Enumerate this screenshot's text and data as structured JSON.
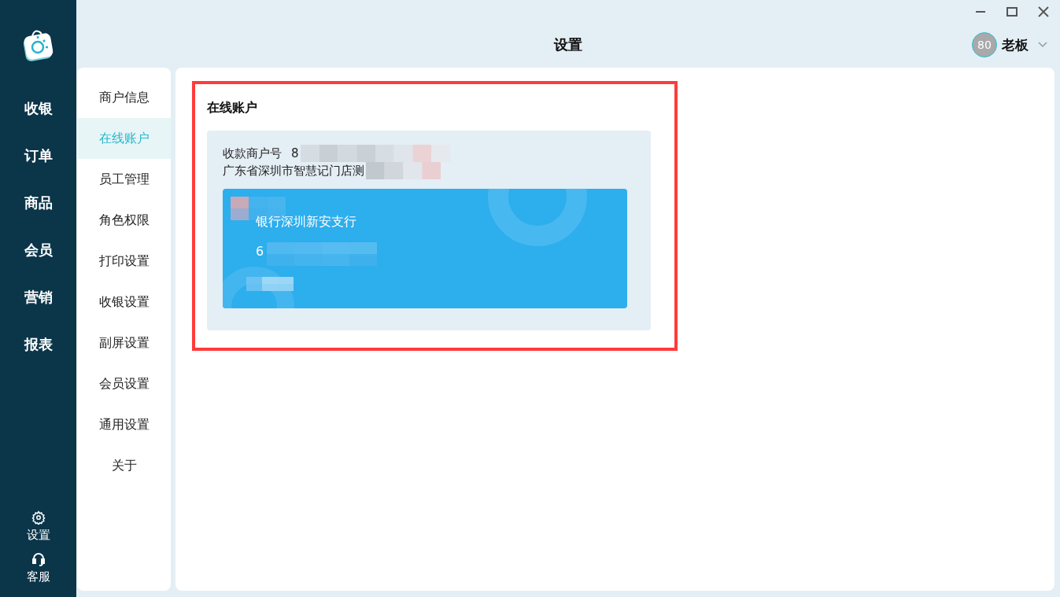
{
  "app_sidebar": {
    "nav_items": [
      {
        "label": "收银"
      },
      {
        "label": "订单"
      },
      {
        "label": "商品"
      },
      {
        "label": "会员"
      },
      {
        "label": "营销"
      },
      {
        "label": "报表"
      }
    ],
    "bottom_items": [
      {
        "kind": "settings",
        "label": "设置"
      },
      {
        "kind": "support",
        "label": "客服"
      }
    ]
  },
  "header": {
    "title": "设置",
    "user": {
      "avatar_text": "80",
      "name": "老板"
    }
  },
  "settings_menu": [
    {
      "label": "商户信息",
      "selected": false
    },
    {
      "label": "在线账户",
      "selected": true
    },
    {
      "label": "员工管理",
      "selected": false
    },
    {
      "label": "角色权限",
      "selected": false
    },
    {
      "label": "打印设置",
      "selected": false
    },
    {
      "label": "收银设置",
      "selected": false
    },
    {
      "label": "副屏设置",
      "selected": false
    },
    {
      "label": "会员设置",
      "selected": false
    },
    {
      "label": "通用设置",
      "selected": false
    },
    {
      "label": "关于",
      "selected": false
    }
  ],
  "online_account": {
    "title": "在线账户",
    "merchant_no": {
      "label": "收款商户号",
      "value": "8"
    },
    "store_name": "广东省深圳市智慧记门店测",
    "bank_card": {
      "bank_name": "银行深圳新安支行",
      "card_number": "6"
    }
  }
}
